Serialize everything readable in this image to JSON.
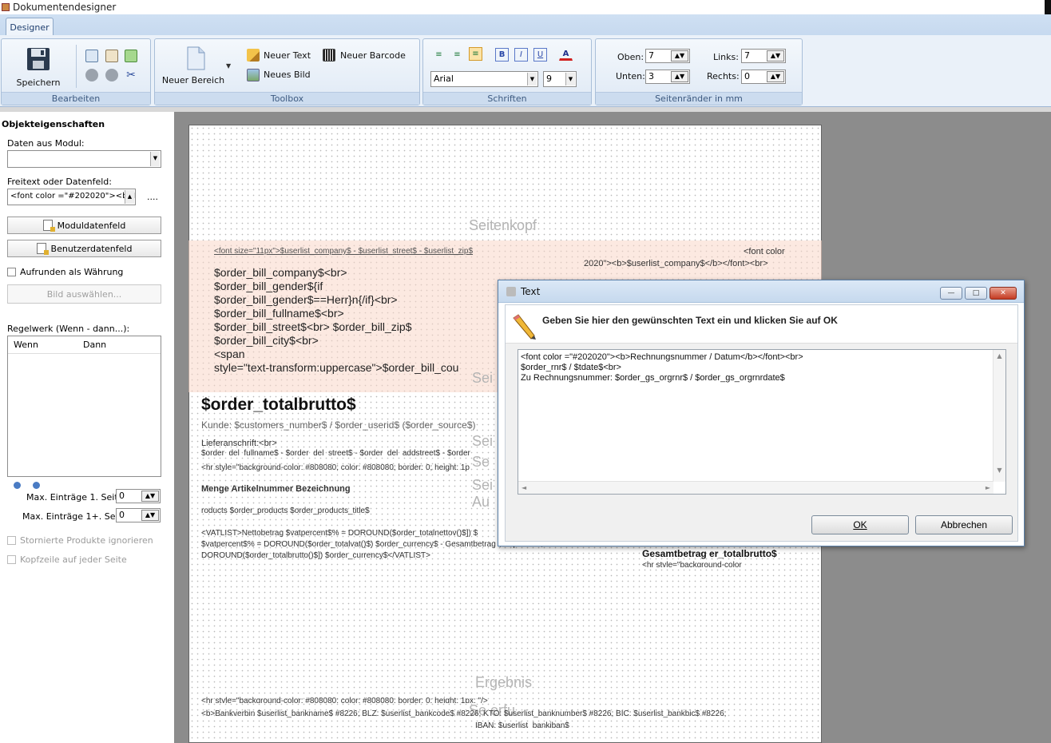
{
  "window": {
    "title": "Dokumentendesigner"
  },
  "ribbon": {
    "tab": "Designer",
    "groups": {
      "bearbeiten": "Bearbeiten",
      "toolbox": "Toolbox",
      "schriften": "Schriften",
      "seitenraender": "Seitenränder in mm"
    },
    "save_label": "Speichern",
    "new_area_label": "Neuer Bereich",
    "new_text_label": "Neuer Text",
    "new_image_label": "Neues Bild",
    "new_barcode_label": "Neuer Barcode",
    "font_name": "Arial",
    "font_size": "9",
    "margins": {
      "oben_label": "Oben:",
      "oben_value": "7",
      "unten_label": "Unten:",
      "unten_value": "3",
      "links_label": "Links:",
      "links_value": "7",
      "rechts_label": "Rechts:",
      "rechts_value": "0"
    }
  },
  "left_panel": {
    "title": "Objekteigenschaften",
    "daten_label": "Daten aus Modul:",
    "daten_value": "",
    "freitext_label": "Freitext oder Datenfeld:",
    "freitext_value": "<font color =\"#202020\"><b>R",
    "ellipsis": "....",
    "moduldatenfeld_label": "Moduldatenfeld",
    "benutzerdatenfeld_label": "Benutzerdatenfeld",
    "aufrunden_label": "Aufrunden als Währung",
    "bild_label": "Bild auswählen...",
    "regelwerk_label": "Regelwerk (Wenn - dann...):",
    "col_wenn": "Wenn",
    "col_dann": "Dann",
    "max1_label": "Max. Einträge 1. Seite",
    "max1_value": "0",
    "maxn_label": "Max. Einträge 1+. Seite",
    "maxn_value": "0",
    "stornierte_label": "Stornierte Produkte ignorieren",
    "kopfzeile_label": "Kopfzeile auf jeder Seite"
  },
  "page": {
    "sections": {
      "seitenkopf": "Seitenkopf",
      "ergebnis": "Ergebnis",
      "partial1": "Sei",
      "partial2": "Sei",
      "partial3": "Se",
      "partial4": "Sei",
      "partial5": "Au",
      "partial6": "Se    erfu"
    },
    "header_line": "<font size=\"11px\">$userlist_company$ - $userlist_street$ - $userlist_zip$",
    "font_color_right1": "<font color",
    "font_color_right2": "2020\"><b>$userlist_company$</b></font><br>",
    "address_lines": [
      "$order_bill_company$<br>",
      "$order_bill_gender${if",
      "$order_bill_gender$==Herr}n{/if}<br>",
      "$order_bill_fullname$<br>",
      "$order_bill_street$<br> $order_bill_zip$",
      "$order_bill_city$<br>",
      "<span",
      "style=\"text-transform:uppercase\">$order_bill_cou"
    ],
    "total_big": "$order_totalbrutto$",
    "kunde_line": "Kunde: $customers_number$ / $order_userid$ ($order_source$)",
    "lieferanschrift": "Lieferanschrift:<br>",
    "order_del_line": "$order_del_fullname$ - $order_del_street$ - $order_del_addstreet$ - $order",
    "hr_line": "<hr style=\"background-color: #808080;  color: #808080; border: 0; height: 1p",
    "table_header": "Menge   Artikelnummer Bezeichnung",
    "products_line": "roducts   $order_products  $order_products_title$",
    "vat_lines": [
      "<VATLIST>Nettobetrag $vatpercent$% = DOROUND($order_totalnettov()$]) $",
      "$vatpercent$% = DOROUND($order_totalvat()$) $order_currency$ - Gesamtbetrag $vatpercent$%",
      "DOROUND($order_totalbrutto()$]) $order_currency$</VATLIST>"
    ],
    "gesamtbetrag": "Gesamtbetrag  er_totalbrutto$",
    "hr_small": "<hr style=\"background-color",
    "footer_hr": "<hr style=\"background-color: #808080;  color: #808080; border: 0; height: 1px; \"/>",
    "footer_bank": "<b>Bankverbin      $userlist_bankname$ #8226; BLZ: $userlist_bankcode$ #8226; KTO: $userlist_banknumber$ #8226; BIC: $userlist_bankbic$ #8226;",
    "footer_iban": "IBAN:  $userlist_bankiban$"
  },
  "dialog": {
    "title": "Text",
    "prompt": "Geben Sie hier den gewünschten Text ein und klicken Sie auf OK",
    "text_lines": [
      "<font color =\"#202020\"><b>Rechnungsnummer / Datum</b></font><br>",
      "$order_rnr$ / $tdate$<br>",
      "Zu Rechnungsnummer: $order_gs_orgrnr$ / $order_gs_orgrnrdate$"
    ],
    "ok_label": "OK",
    "cancel_label": "Abbrechen"
  }
}
